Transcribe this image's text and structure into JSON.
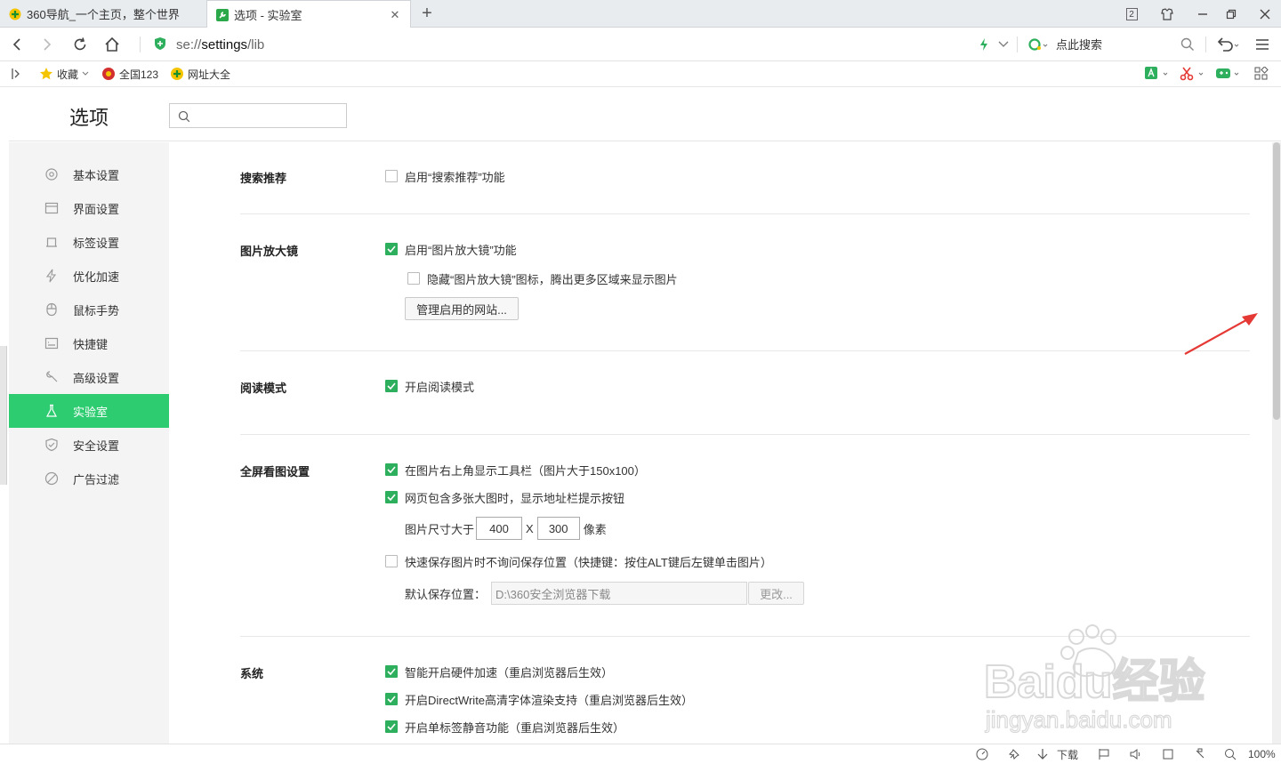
{
  "tabs": [
    {
      "title": "360导航_一个主页，整个世界",
      "active": false
    },
    {
      "title": "选项 - 实验室",
      "active": true
    }
  ],
  "window": {
    "badge_count": "2"
  },
  "address": {
    "url_scheme": "se://",
    "url_path": "settings",
    "url_rest": "/lib",
    "search_label": "点此搜索"
  },
  "bookmarks": [
    {
      "label": "收藏",
      "icon": "star-icon"
    },
    {
      "label": "全国123",
      "icon": "emblem-icon"
    },
    {
      "label": "网址大全",
      "icon": "360-icon"
    }
  ],
  "settings": {
    "title": "选项",
    "search_placeholder": ""
  },
  "sidebar": {
    "items": [
      {
        "label": "基本设置",
        "icon": "gear-icon"
      },
      {
        "label": "界面设置",
        "icon": "window-icon"
      },
      {
        "label": "标签设置",
        "icon": "tab-icon"
      },
      {
        "label": "优化加速",
        "icon": "lightning-icon"
      },
      {
        "label": "鼠标手势",
        "icon": "mouse-icon"
      },
      {
        "label": "快捷键",
        "icon": "keyboard-icon"
      },
      {
        "label": "高级设置",
        "icon": "wrench-icon"
      },
      {
        "label": "实验室",
        "icon": "flask-icon",
        "active": true
      },
      {
        "label": "安全设置",
        "icon": "shield-icon"
      },
      {
        "label": "广告过滤",
        "icon": "block-icon"
      }
    ]
  },
  "sections": {
    "search_recommend": {
      "title": "搜索推荐",
      "enable": {
        "label": "启用“搜索推荐”功能",
        "checked": false
      }
    },
    "magnifier": {
      "title": "图片放大镜",
      "enable": {
        "label": "启用“图片放大镜”功能",
        "checked": true
      },
      "hide_icon": {
        "label": "隐藏“图片放大镜”图标，腾出更多区域来显示图片",
        "checked": false
      },
      "manage_button": "管理启用的网站..."
    },
    "reading": {
      "title": "阅读模式",
      "enable": {
        "label": "开启阅读模式",
        "checked": true
      }
    },
    "fullscreen": {
      "title": "全屏看图设置",
      "toolbar": {
        "label": "在图片右上角显示工具栏（图片大于150x100）",
        "checked": true
      },
      "multi": {
        "label": "网页包含多张大图时，显示地址栏提示按钮",
        "checked": true
      },
      "size_label": "图片尺寸大于",
      "width": "400",
      "x_label": "X",
      "height": "300",
      "unit": "像素",
      "quick_save": {
        "label": "快速保存图片时不询问保存位置（快捷键：按住ALT键后左键单击图片）",
        "checked": false
      },
      "path_label": "默认保存位置：",
      "path_value": "D:\\360安全浏览器下载",
      "change_button": "更改..."
    },
    "system": {
      "title": "系统",
      "hw": {
        "label": "智能开启硬件加速（重启浏览器后生效）",
        "checked": true
      },
      "dw": {
        "label": "开启DirectWrite高清字体渲染支持（重启浏览器后生效）",
        "checked": true
      },
      "mute": {
        "label": "开启单标签静音功能（重启浏览器后生效）",
        "checked": true
      }
    }
  },
  "statusbar": {
    "download_label": "下载",
    "zoom": "100%"
  },
  "watermark": {
    "text": "Baidu经验",
    "sub": "jingyan.baidu.com"
  },
  "colors": {
    "accent": "#2ecc71",
    "checkbox": "#2eaf5d",
    "arrow": "#e53935"
  }
}
